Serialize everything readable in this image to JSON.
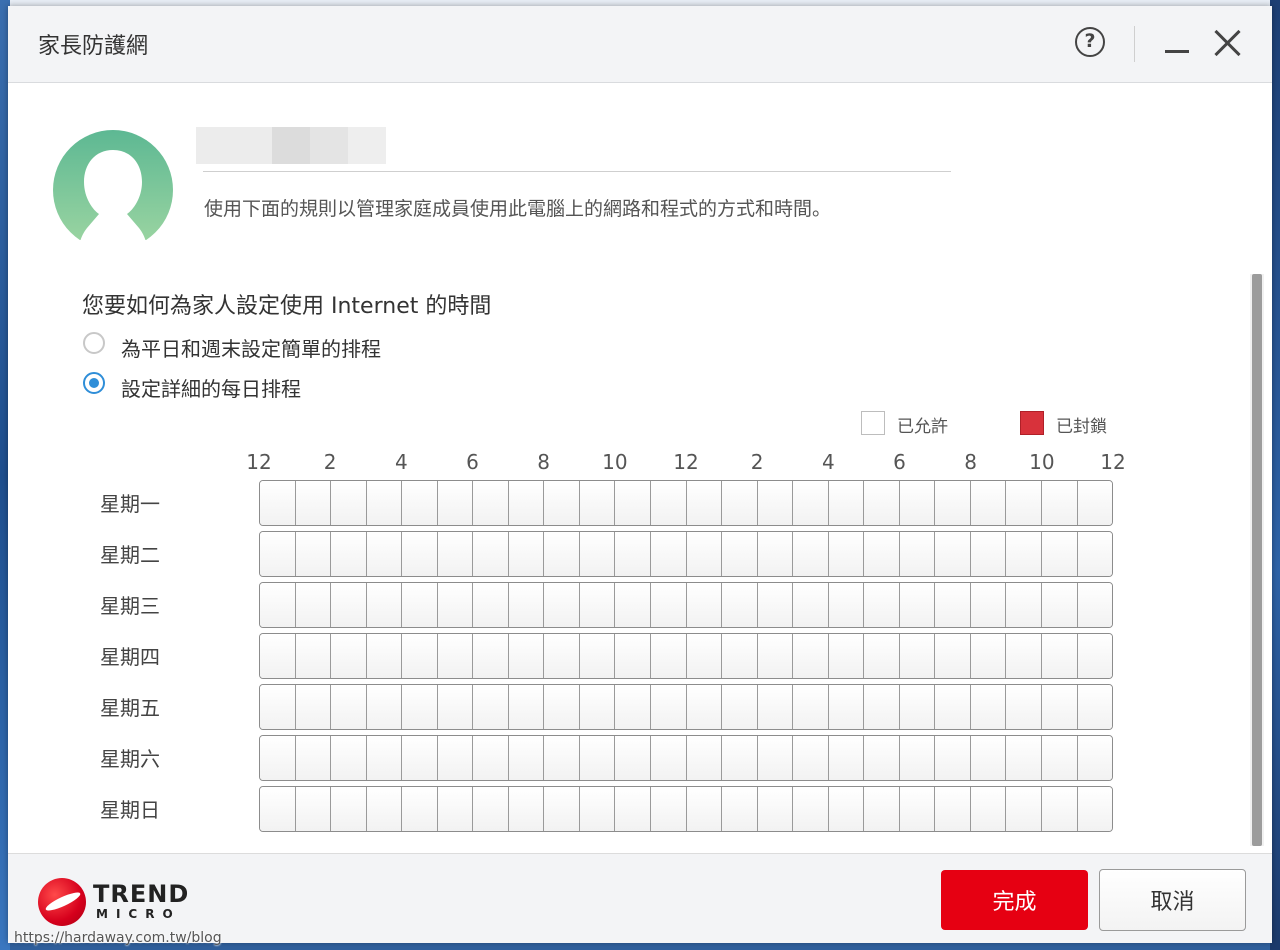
{
  "window": {
    "title": "家長防護網"
  },
  "profile": {
    "description": "使用下面的規則以管理家庭成員使用此電腦上的網路和程式的方式和時間。"
  },
  "schedule": {
    "question": "您要如何為家人設定使用 Internet 的時間",
    "options": [
      {
        "label": "為平日和週末設定簡單的排程",
        "selected": false
      },
      {
        "label": "設定詳細的每日排程",
        "selected": true
      }
    ],
    "legend": {
      "allowed": "已允許",
      "blocked": "已封鎖"
    },
    "hour_ticks": [
      "12",
      "2",
      "4",
      "6",
      "8",
      "10",
      "12",
      "2",
      "4",
      "6",
      "8",
      "10",
      "12"
    ],
    "days": [
      "星期一",
      "星期二",
      "星期三",
      "星期四",
      "星期五",
      "星期六",
      "星期日"
    ],
    "blocked_slots": []
  },
  "colors": {
    "accent": "#e60012",
    "radio": "#2f8ed8",
    "blocked": "#d8323b"
  },
  "footer": {
    "brand_line1": "TREND",
    "brand_line2": "MICRO",
    "done_label": "完成",
    "cancel_label": "取消"
  },
  "watermark": "https://hardaway.com.tw/blog"
}
